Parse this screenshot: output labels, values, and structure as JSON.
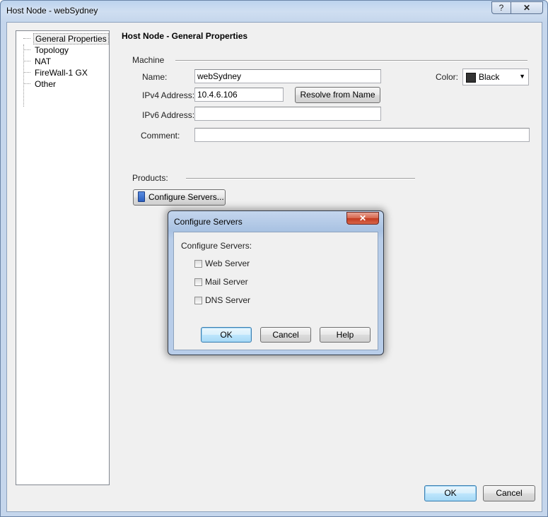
{
  "window": {
    "title": "Host Node - webSydney",
    "help_label": "?",
    "close_label": "✕"
  },
  "tree": {
    "items": [
      {
        "label": "General Properties",
        "selected": true
      },
      {
        "label": "Topology"
      },
      {
        "label": "NAT"
      },
      {
        "label": "FireWall-1 GX"
      },
      {
        "label": "Other"
      }
    ]
  },
  "heading": "Host Node - General Properties",
  "machine": {
    "section_label": "Machine",
    "name_label": "Name:",
    "name_value": "webSydney",
    "ipv4_label": "IPv4 Address:",
    "ipv4_value": "10.4.6.106",
    "resolve_label": "Resolve from Name",
    "ipv6_label": "IPv6 Address:",
    "ipv6_value": "",
    "comment_label": "Comment:",
    "comment_value": "",
    "color_label": "Color:",
    "color_value": "Black",
    "color_swatch": "#333333"
  },
  "products": {
    "section_label": "Products:",
    "configure_label": "Configure Servers..."
  },
  "footer": {
    "ok_label": "OK",
    "cancel_label": "Cancel"
  },
  "modal": {
    "title": "Configure Servers",
    "close_label": "✕",
    "group_label": "Configure Servers:",
    "options": [
      {
        "label": "Web Server",
        "checked": false
      },
      {
        "label": "Mail Server",
        "checked": false
      },
      {
        "label": "DNS Server",
        "checked": false
      }
    ],
    "ok_label": "OK",
    "cancel_label": "Cancel",
    "help_label": "Help"
  }
}
